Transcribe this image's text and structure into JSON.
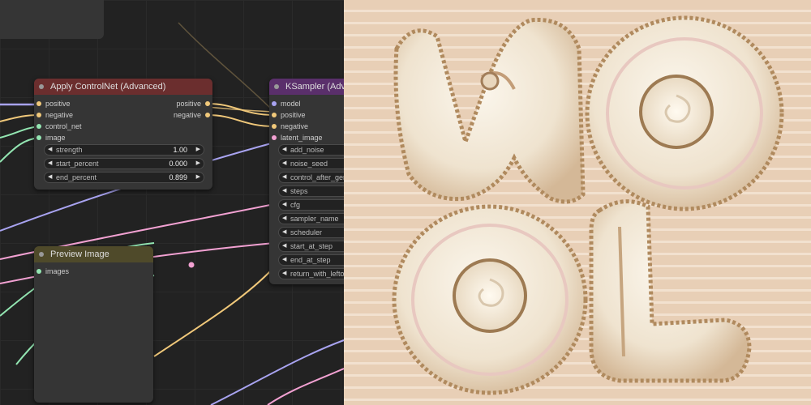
{
  "nodes": {
    "apply_controlnet": {
      "title": "Apply ControlNet (Advanced)",
      "inputs": [
        "positive",
        "negative",
        "control_net",
        "image"
      ],
      "outputs": [
        "positive",
        "negative"
      ],
      "widgets": [
        {
          "label": "strength",
          "value": "1.00"
        },
        {
          "label": "start_percent",
          "value": "0.000"
        },
        {
          "label": "end_percent",
          "value": "0.899"
        }
      ]
    },
    "ksampler": {
      "title": "KSampler (Adva",
      "inputs": [
        "model",
        "positive",
        "negative",
        "latent_image"
      ],
      "widgets": [
        "add_noise",
        "noise_seed",
        "control_after_gene",
        "steps",
        "cfg",
        "sampler_name",
        "scheduler",
        "start_at_step",
        "end_at_step",
        "return_with_leftov"
      ]
    },
    "preview_image": {
      "title": "Preview Image",
      "inputs": [
        "images"
      ]
    }
  },
  "colors": {
    "conditioning": "#f0c87a",
    "model": "#a8a3f0",
    "control_net": "#93e6b2",
    "image": "#93e6b2",
    "latent": "#f2a1d2",
    "controlnet_header": "#6b2e2e",
    "ksampler_header": "#5a2f6b",
    "preview_header": "#4f4a2a"
  },
  "icons": {
    "arrow_left": "◀",
    "arrow_right": "▶"
  }
}
